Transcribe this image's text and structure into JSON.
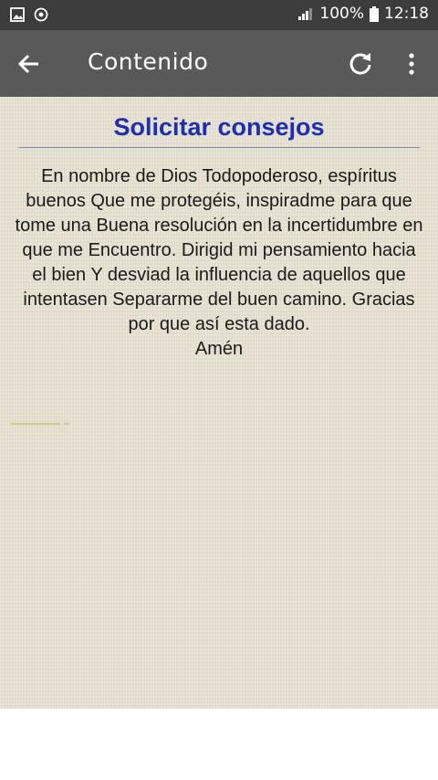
{
  "status_bar": {
    "battery_percent": "100%",
    "time": "12:18",
    "left_icons": [
      "image-icon",
      "sync-icon"
    ]
  },
  "app_bar": {
    "title": "Contenido",
    "icons": [
      "back-arrow-icon",
      "refresh-icon",
      "more-vert-icon"
    ]
  },
  "content": {
    "heading": "Solicitar consejos",
    "body": "En nombre de Dios Todopoderoso, espíritus buenos Que me protegéis, inspiradme para que tome una Buena resolución en la incertidumbre en que me Encuentro. Dirigid mi pensamiento hacia el bien Y desviad la influencia de aquellos que intentasen Separarme del buen camino. Gracias por que así esta dado.",
    "closing": "Amén"
  },
  "colors": {
    "status_bar": "#3c3c3c",
    "app_bar": "#595959",
    "content_bg": "#e8e2d2",
    "heading": "#1e2eb0",
    "divider": "#7d8db5"
  }
}
